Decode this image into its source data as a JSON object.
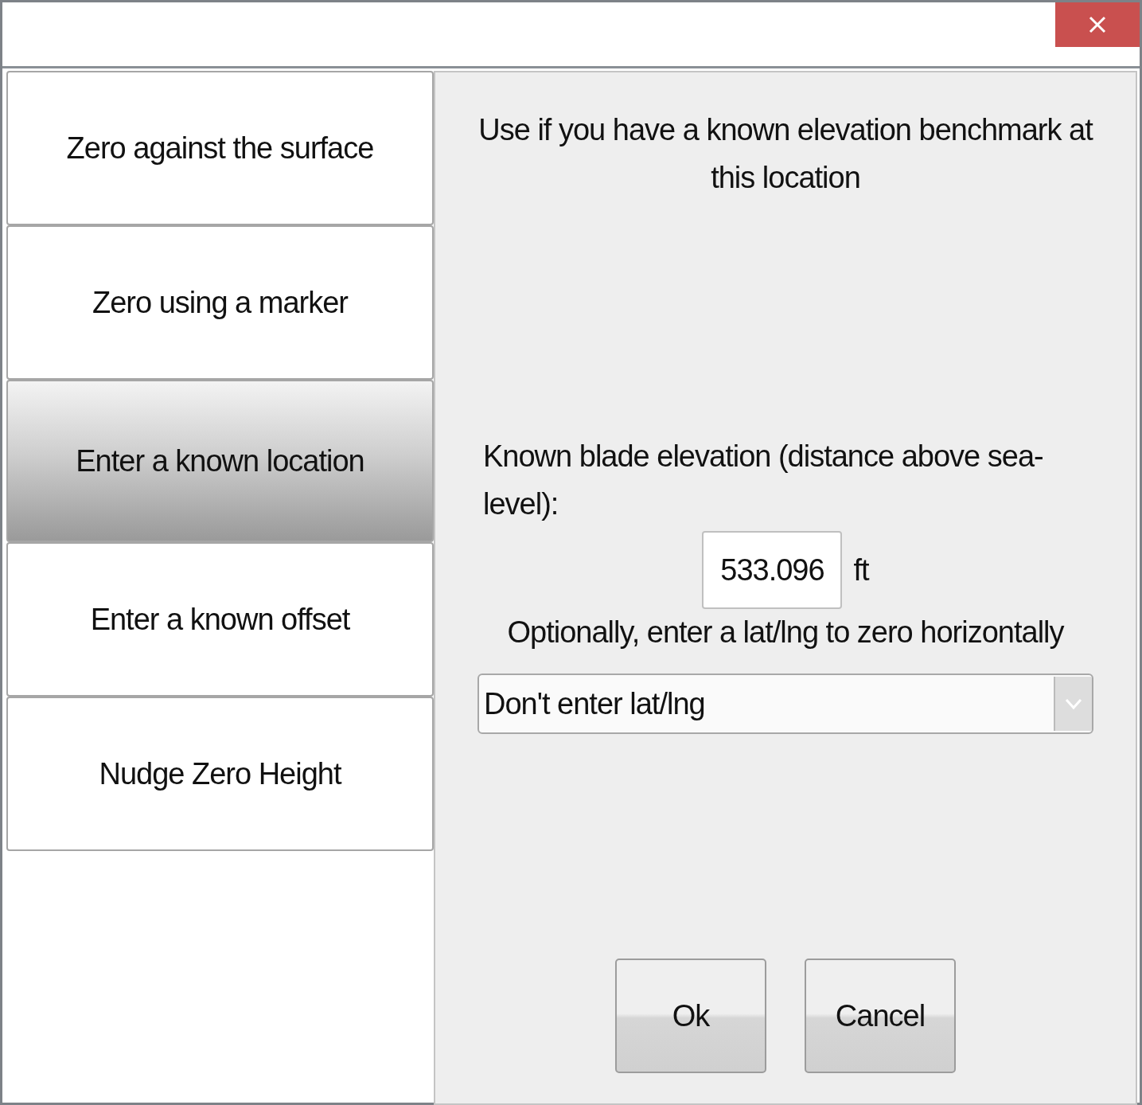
{
  "options": [
    {
      "label": "Zero against the surface",
      "selected": false
    },
    {
      "label": "Zero using a marker",
      "selected": false
    },
    {
      "label": "Enter a known location",
      "selected": true
    },
    {
      "label": "Enter a known offset",
      "selected": false
    },
    {
      "label": "Nudge Zero Height",
      "selected": false
    }
  ],
  "description": "Use if you have a known elevation benchmark at this location",
  "elevation": {
    "label": "Known blade elevation (distance above sea-level):",
    "value": "533.096",
    "unit": "ft"
  },
  "latlng": {
    "label": "Optionally, enter a lat/lng to zero horizontally",
    "value": "Don't enter lat/lng"
  },
  "buttons": [
    "Ok",
    "Cancel"
  ]
}
